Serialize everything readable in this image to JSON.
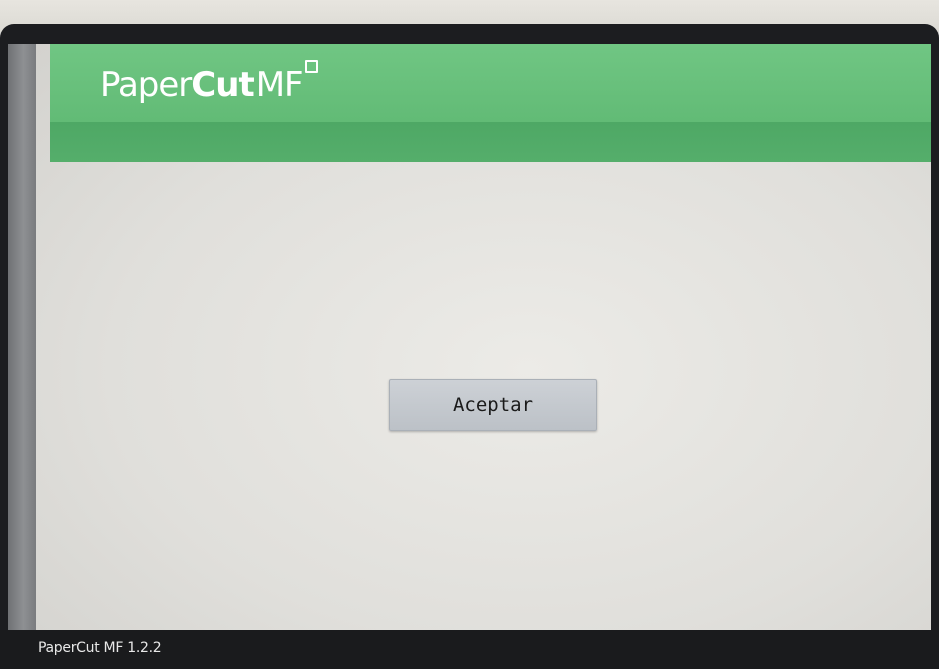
{
  "app": {
    "logo_paper": "Paper",
    "logo_cut": "Cut",
    "logo_mf": "MF"
  },
  "dialog": {
    "accept_label": "Aceptar"
  },
  "footer": {
    "version_text": "PaperCut MF 1.2.2"
  },
  "colors": {
    "header_green": "#62bb76",
    "header_band_green": "#4ea865",
    "button_grey": "#c6cacf"
  }
}
